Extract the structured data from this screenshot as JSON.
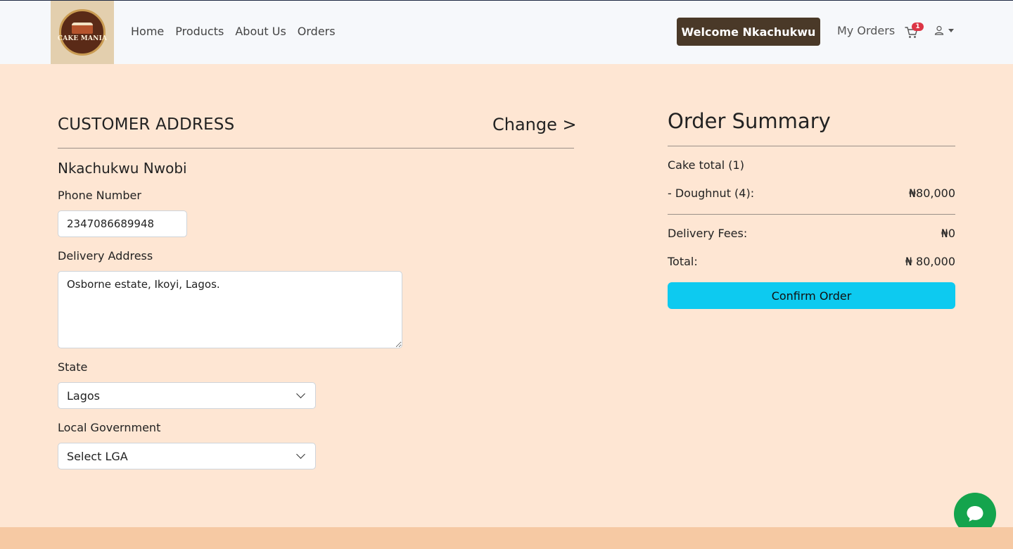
{
  "brand": {
    "logo_text": "CAKE MANIA"
  },
  "nav": {
    "links": [
      "Home",
      "Products",
      "About Us",
      "Orders"
    ],
    "welcome_label": "Welcome Nkachukwu",
    "my_orders_label": "My Orders",
    "cart_count": "1",
    "cart_icon": "cart-icon",
    "user_icon": "user-icon"
  },
  "address": {
    "title": "CUSTOMER ADDRESS",
    "change_label": "Change >",
    "customer_name": "Nkachukwu Nwobi",
    "phone_label": "Phone Number",
    "phone_value": "2347086689948",
    "delivery_label": "Delivery Address",
    "delivery_value": "Osborne estate, Ikoyi, Lagos.",
    "state_label": "State",
    "state_value": "Lagos",
    "lga_label": "Local Government",
    "lga_value": "Select LGA"
  },
  "summary": {
    "title": "Order Summary",
    "cake_total_label": "Cake total (1)",
    "item_label": "- Doughnut (4):",
    "item_price": "₦80,000",
    "delivery_label": "Delivery Fees:",
    "delivery_value": "₦0",
    "total_label": "Total:",
    "total_value": "₦ 80,000",
    "confirm_label": "Confirm Order"
  },
  "colors": {
    "page_bg": "#fee6d3",
    "navbar_bg": "#f6f8fb",
    "welcome_bg": "#4a3928",
    "confirm_bg": "#0dcaf0",
    "chat_bg": "#14a44d",
    "badge": "#dc3545",
    "footer": "#f6c9a3"
  },
  "chat_icon": "chat-bubble-icon"
}
